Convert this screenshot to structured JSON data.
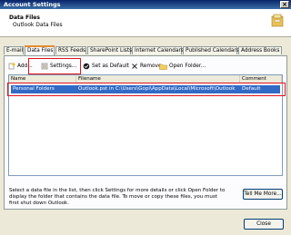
{
  "window": {
    "title": "Account Settings",
    "close_glyph": "×"
  },
  "header": {
    "title": "Data Files",
    "subtitle": "Outlook Data Files"
  },
  "tabs": [
    {
      "label": "E-mail",
      "active": false
    },
    {
      "label": "Data Files",
      "active": true
    },
    {
      "label": "RSS Feeds",
      "active": false
    },
    {
      "label": "SharePoint Lists",
      "active": false
    },
    {
      "label": "Internet Calendars",
      "active": false
    },
    {
      "label": "Published Calendars",
      "active": false
    },
    {
      "label": "Address Books",
      "active": false
    }
  ],
  "toolbar": {
    "add": "Add...",
    "settings": "Settings...",
    "set_default": "Set as Default",
    "remove": "Remove",
    "open_folder": "Open Folder..."
  },
  "list": {
    "columns": [
      "Name",
      "Filename",
      "Comment"
    ],
    "rows": [
      {
        "name": "Personal Folders",
        "filename": "Outlook.pst in C:\\Users\\Gopi\\AppData\\Local\\Microsoft\\Outlook",
        "comment": "Default"
      }
    ]
  },
  "help_text": "Select a data file in the list, then click Settings for more details or click Open Folder to display the folder that contains the data file. To move or copy these files, you must first shut down Outlook.",
  "buttons": {
    "tell_me_more": "Tell Me More...",
    "close": "Close"
  },
  "colors": {
    "highlight": "#e0141b",
    "selection": "#316ac5"
  }
}
